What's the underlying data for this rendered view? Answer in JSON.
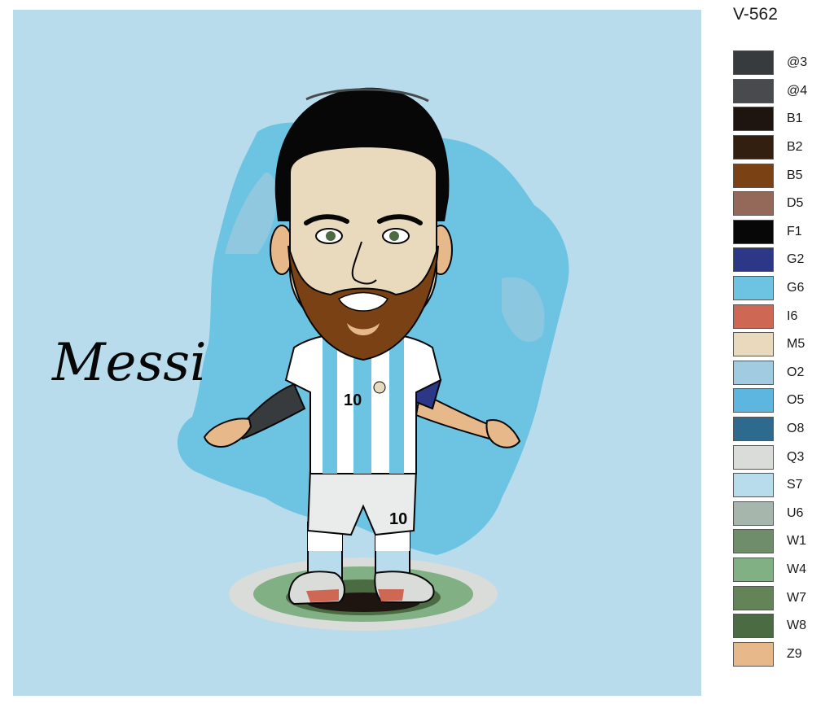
{
  "product_code": "V-562",
  "artwork": {
    "title_script": "Messi",
    "shirt_number": "10",
    "shorts_number": "10"
  },
  "palette": [
    {
      "code": "@3",
      "color": "#373b3d"
    },
    {
      "code": "@4",
      "color": "#474b4d"
    },
    {
      "code": "B1",
      "color": "#1e1410"
    },
    {
      "code": "B2",
      "color": "#321f10"
    },
    {
      "code": "B5",
      "color": "#7a4214"
    },
    {
      "code": "D5",
      "color": "#94695a"
    },
    {
      "code": "F1",
      "color": "#070708"
    },
    {
      "code": "G2",
      "color": "#2c3787"
    },
    {
      "code": "G6",
      "color": "#6dc4e2"
    },
    {
      "code": "I6",
      "color": "#cf6755"
    },
    {
      "code": "M5",
      "color": "#e9d9bd"
    },
    {
      "code": "O2",
      "color": "#a0cbe0"
    },
    {
      "code": "O5",
      "color": "#5db6e0"
    },
    {
      "code": "O8",
      "color": "#2e6a8e"
    },
    {
      "code": "Q3",
      "color": "#d9dcd8"
    },
    {
      "code": "S7",
      "color": "#b8dceb"
    },
    {
      "code": "U6",
      "color": "#a6b6ad"
    },
    {
      "code": "W1",
      "color": "#6f8c6b"
    },
    {
      "code": "W4",
      "color": "#82b085"
    },
    {
      "code": "W7",
      "color": "#628456"
    },
    {
      "code": "W8",
      "color": "#4b6c42"
    },
    {
      "code": "Z9",
      "color": "#e6b88a"
    }
  ]
}
